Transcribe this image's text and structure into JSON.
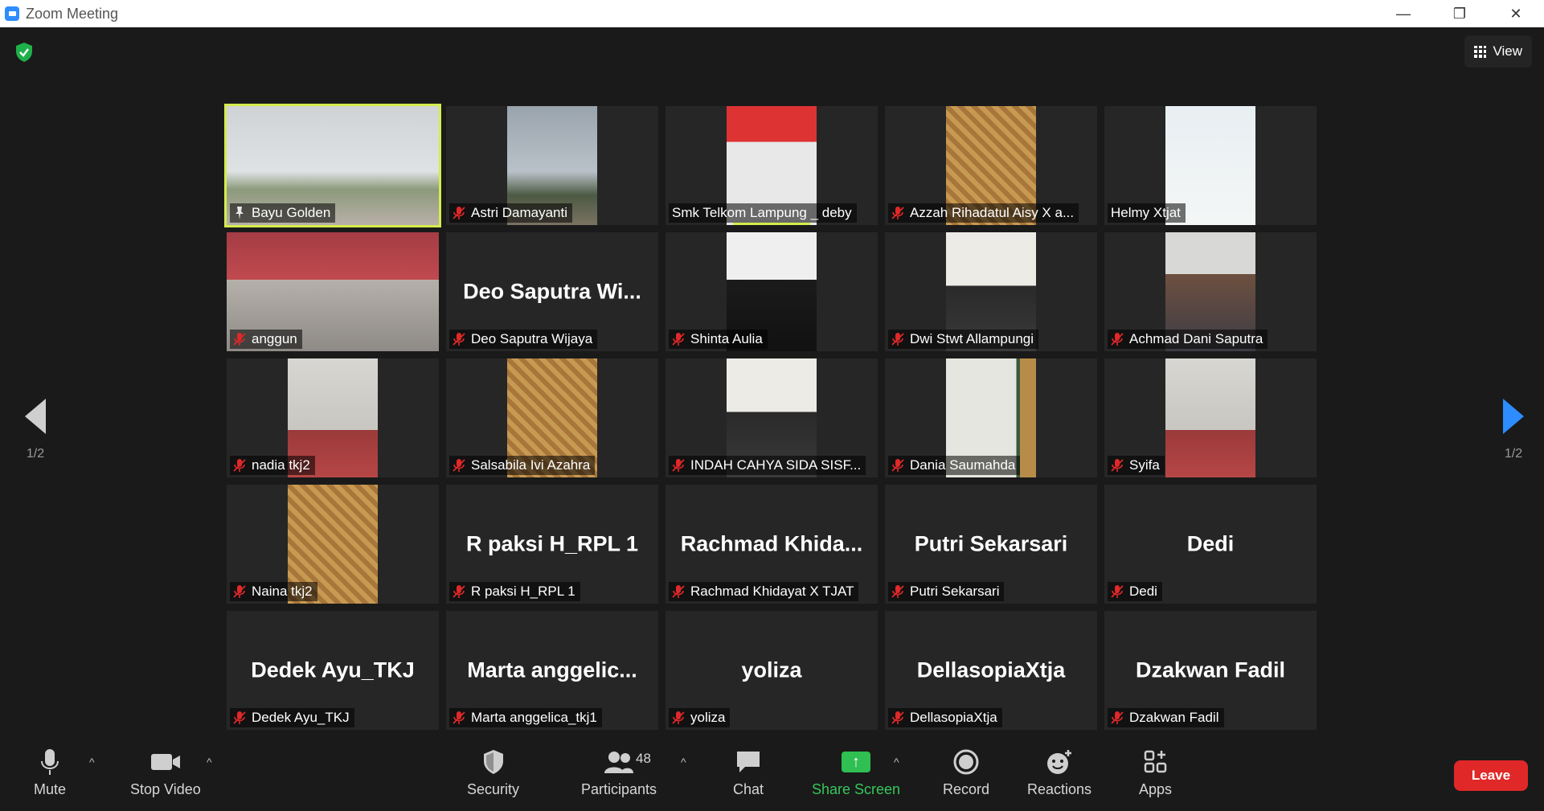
{
  "window": {
    "title": "Zoom Meeting",
    "minimize": "—",
    "restore": "❐",
    "close": "✕"
  },
  "header": {
    "view_label": "View"
  },
  "pagination": {
    "left_page": "1/2",
    "right_page": "1/2"
  },
  "tiles": [
    {
      "name": "Bayu Golden",
      "label": "Bayu Golden",
      "video": "v-school wide",
      "active": true,
      "mic": "pin"
    },
    {
      "name": "Astri Damayanti",
      "label": "Astri Damayanti",
      "video": "v-sky",
      "mic": "muted"
    },
    {
      "name": "Smk Telkom Lampung _ deby",
      "label": "Smk Telkom Lampung _ deby",
      "video": "v-red",
      "mic": "none",
      "speaking": true
    },
    {
      "name": "Azzah Rihadatul Aisy X a...",
      "label": "Azzah Rihadatul Aisy X a...",
      "video": "v-window",
      "mic": "muted"
    },
    {
      "name": "Helmy Xtjat",
      "label": "Helmy Xtjat",
      "video": "v-white",
      "mic": "none"
    },
    {
      "name": "anggun",
      "label": "anggun",
      "video": "v-hijab wide",
      "mic": "muted"
    },
    {
      "name": "Deo Saputra Wi...",
      "label": "Deo Saputra Wijaya",
      "video": "",
      "mic": "muted"
    },
    {
      "name": "Shinta Aulia",
      "label": "Shinta Aulia",
      "video": "v-dark",
      "mic": "muted"
    },
    {
      "name": "Dwi Stwt Allampungi",
      "label": "Dwi Stwt Allampungi",
      "video": "v-mask",
      "mic": "muted"
    },
    {
      "name": "Achmad Dani Saputra",
      "label": "Achmad Dani Saputra",
      "video": "v-face",
      "mic": "muted"
    },
    {
      "name": "nadia tkj2",
      "label": "nadia tkj2",
      "video": "v-room",
      "mic": "muted"
    },
    {
      "name": "Salsabila Ivi Azahra",
      "label": "Salsabila Ivi Azahra",
      "video": "v-window",
      "mic": "muted"
    },
    {
      "name": "INDAH CAHYA SIDA SISF...",
      "label": "INDAH CAHYA SIDA SISF...",
      "video": "v-mask",
      "mic": "muted"
    },
    {
      "name": "Dania Saumahda",
      "label": "Dania Saumahda",
      "video": "v-wallstripe",
      "mic": "muted"
    },
    {
      "name": "Syifa",
      "label": "Syifa",
      "video": "v-room",
      "mic": "muted"
    },
    {
      "name": "Naina tkj2",
      "label": "Naina tkj2",
      "video": "v-window",
      "mic": "muted"
    },
    {
      "name": "R paksi H_RPL 1",
      "label": "R paksi H_RPL 1",
      "video": "",
      "mic": "muted"
    },
    {
      "name": "Rachmad  Khida...",
      "label": "Rachmad Khidayat X TJAT",
      "video": "",
      "mic": "muted"
    },
    {
      "name": "Putri Sekarsari",
      "label": "Putri Sekarsari",
      "video": "",
      "mic": "muted"
    },
    {
      "name": "Dedi",
      "label": "Dedi",
      "video": "",
      "mic": "muted"
    },
    {
      "name": "Dedek Ayu_TKJ",
      "label": "Dedek Ayu_TKJ",
      "video": "",
      "mic": "muted"
    },
    {
      "name": "Marta  anggelic...",
      "label": "Marta anggelica_tkj1",
      "video": "",
      "mic": "muted"
    },
    {
      "name": "yoliza",
      "label": "yoliza",
      "video": "",
      "mic": "muted"
    },
    {
      "name": "DellasopiaXtja",
      "label": "DellasopiaXtja",
      "video": "",
      "mic": "muted"
    },
    {
      "name": "Dzakwan Fadil",
      "label": "Dzakwan Fadil",
      "video": "",
      "mic": "muted"
    }
  ],
  "toolbar": {
    "mute_label": "Mute",
    "stop_video_label": "Stop Video",
    "security_label": "Security",
    "participants_label": "Participants",
    "participants_count": "48",
    "chat_label": "Chat",
    "share_screen_label": "Share Screen",
    "record_label": "Record",
    "reactions_label": "Reactions",
    "apps_label": "Apps",
    "leave_label": "Leave",
    "caret": "^"
  },
  "colors": {
    "background": "#1a1a1a",
    "tile": "#262626",
    "active_speaker": "#d4ec4c",
    "share_green": "#2fbf52",
    "leave_red": "#e02828",
    "accent_blue": "#2d8cff",
    "muted_red": "#e02828"
  },
  "icons": [
    "zoom-app-icon",
    "shield-check-icon",
    "grid-view-icon",
    "microphone-icon",
    "video-camera-icon",
    "security-shield-icon",
    "participants-icon",
    "chat-bubble-icon",
    "share-screen-icon",
    "record-icon",
    "reactions-icon",
    "apps-icon",
    "mic-muted-icon",
    "pin-icon"
  ]
}
